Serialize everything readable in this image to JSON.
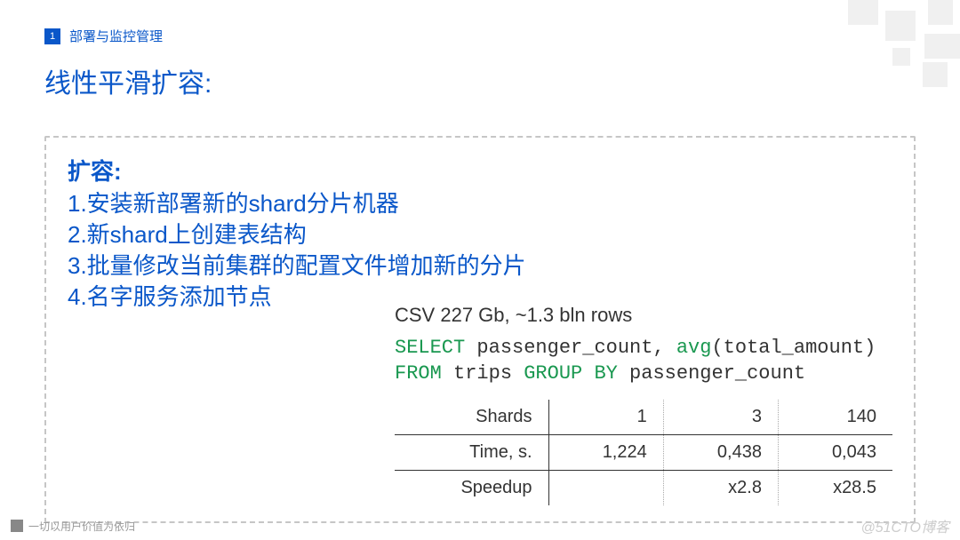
{
  "header": {
    "number": "1",
    "breadcrumb": "部署与监控管理"
  },
  "title": "线性平滑扩容:",
  "box": {
    "heading": "扩容:",
    "steps": {
      "s1": "1.安装新部署新的shard分片机器",
      "s2": "2.新shard上创建表结构",
      "s3": "3.批量修改当前集群的配置文件增加新的分片",
      "s4": "4.名字服务添加节点"
    }
  },
  "csv_note": "CSV 227 Gb, ~1.3 bln rows",
  "sql": {
    "kw_select": "SELECT",
    "col1": " passenger_count, ",
    "kw_avg": "avg",
    "col2": "(total_amount)",
    "kw_from": "FROM",
    "tbl": " trips ",
    "kw_group": "GROUP BY",
    "col3": " passenger_count"
  },
  "chart_data": {
    "type": "table",
    "columns": [
      "Shards",
      "1",
      "3",
      "140"
    ],
    "rows": [
      {
        "label": "Time, s.",
        "v1": "1,224",
        "v2": "0,438",
        "v3": "0,043"
      },
      {
        "label": "Speedup",
        "v1": "",
        "v2": "x2.8",
        "v3": "x28.5"
      }
    ]
  },
  "footer": {
    "tagline": "一切以用户价值为依归",
    "watermark": "@51CTO博客"
  }
}
